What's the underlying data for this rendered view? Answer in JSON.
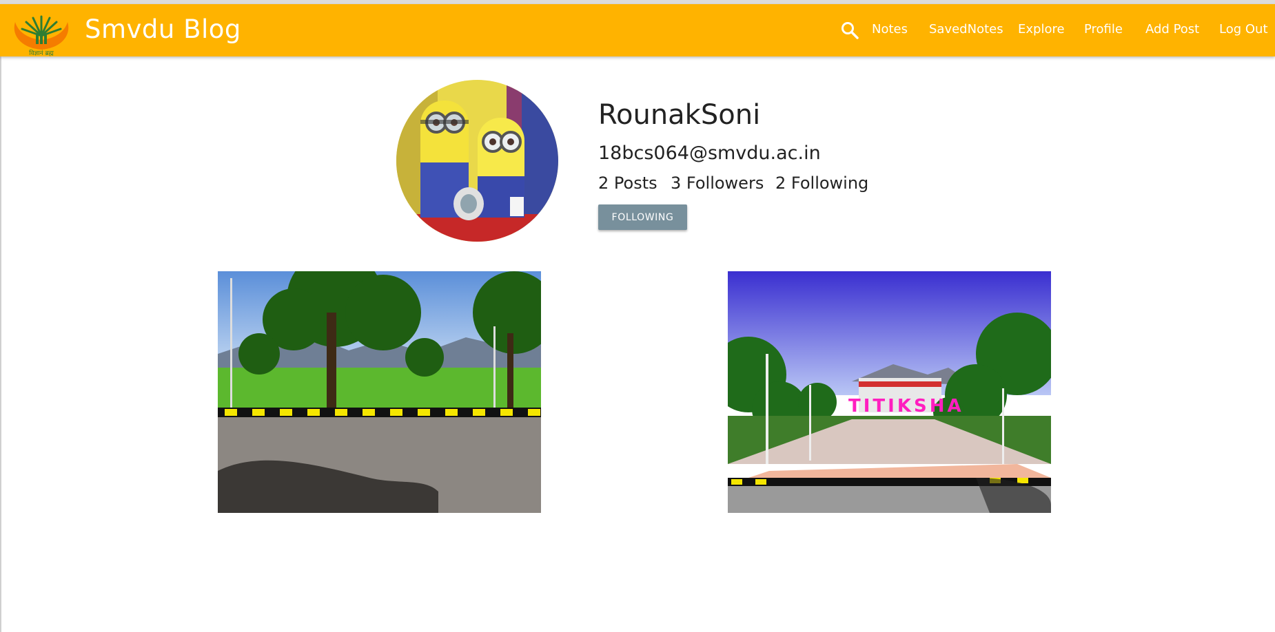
{
  "navbar": {
    "brand": "Smvdu Blog",
    "logo_caption": "विज्ञानं ब्रह्म",
    "search_icon": "search-icon",
    "links": [
      "Notes",
      "SavedNotes",
      "Explore",
      "Profile",
      "Add Post",
      "Log Out"
    ],
    "background_color": "#ffb300"
  },
  "profile": {
    "name": "RounakSoni",
    "email": "18bcs064@smvdu.ac.in",
    "posts": "2 Posts",
    "followers": "3 Followers",
    "following": "2 Following",
    "follow_button": "FOLLOWING",
    "overlay_text_in_post_2": "TITIKSHA"
  },
  "colors": {
    "accent": "#ffb300",
    "button": "#78909c"
  }
}
